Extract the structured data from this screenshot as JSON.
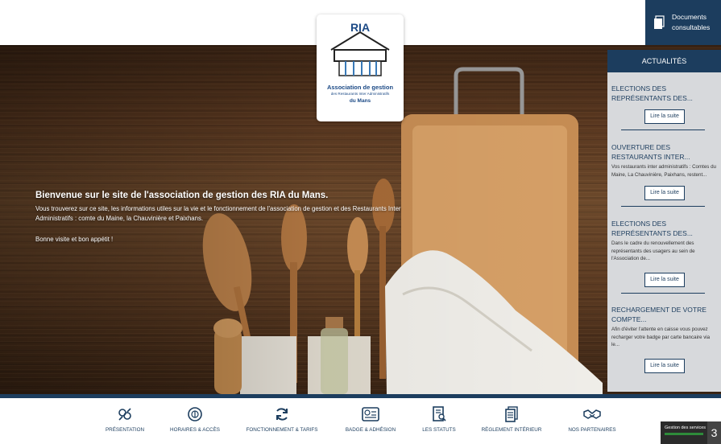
{
  "header": {
    "docs_label": "Documents consultables"
  },
  "logo": {
    "acronym": "RIA",
    "line1": "Association de gestion",
    "line2": "des Restaurants Inter Administratifs",
    "line3": "du Mans"
  },
  "intro": {
    "title": "Bienvenue sur le site de l'association de gestion des RIA du Mans.",
    "body": "Vous trouverez sur ce site, les informations utiles sur la vie et le fonctionnement de l'association de gestion et des Restaurants Inter Administratifs : comte du Maine, la Chauvinière et Paixhans.",
    "greeting": "Bonne visite et bon appétit !"
  },
  "news": {
    "heading": "ACTUALITÉS",
    "read_more": "Lire la suite",
    "items": [
      {
        "title": "ELECTIONS DES REPRÉSENTANTS DES...",
        "text": ""
      },
      {
        "title": "OUVERTURE DES RESTAURANTS INTER...",
        "text": "Vos restaurants inter administratifs : Comtes du Maine, La Chauvinière, Paixhans, restent..."
      },
      {
        "title": "ELECTIONS DES REPRÉSENTANTS DES...",
        "text": "Dans le cadre du renouvellement des représentants des usagers au sein de l'Association de..."
      },
      {
        "title": "RECHARGEMENT DE VOTRE COMPTE...",
        "text": "Afin d'éviter l'attente en caisse vous pouvez recharger votre badge par carte bancaire via le..."
      }
    ]
  },
  "nav": {
    "items": [
      {
        "label": "PRÉSENTATION",
        "icon": "hands-icon"
      },
      {
        "label": "HORAIRES & ACCÈS",
        "icon": "plate-icon"
      },
      {
        "label": "FONCTIONNEMENT & TARIFS",
        "icon": "refresh-icon"
      },
      {
        "label": "BADGE & ADHÉSION",
        "icon": "badge-icon"
      },
      {
        "label": "LES STATUTS",
        "icon": "document-search-icon"
      },
      {
        "label": "RÈGLEMENT INTÉRIEUR",
        "icon": "documents-icon"
      },
      {
        "label": "NOS PARTENAIRES",
        "icon": "handshake-icon"
      }
    ]
  },
  "services": {
    "label": "Gestion des services",
    "count": "3"
  },
  "colors": {
    "navy": "#1c3d5e",
    "panel": "#d7d9dc",
    "logo_blue": "#1c4a86"
  }
}
